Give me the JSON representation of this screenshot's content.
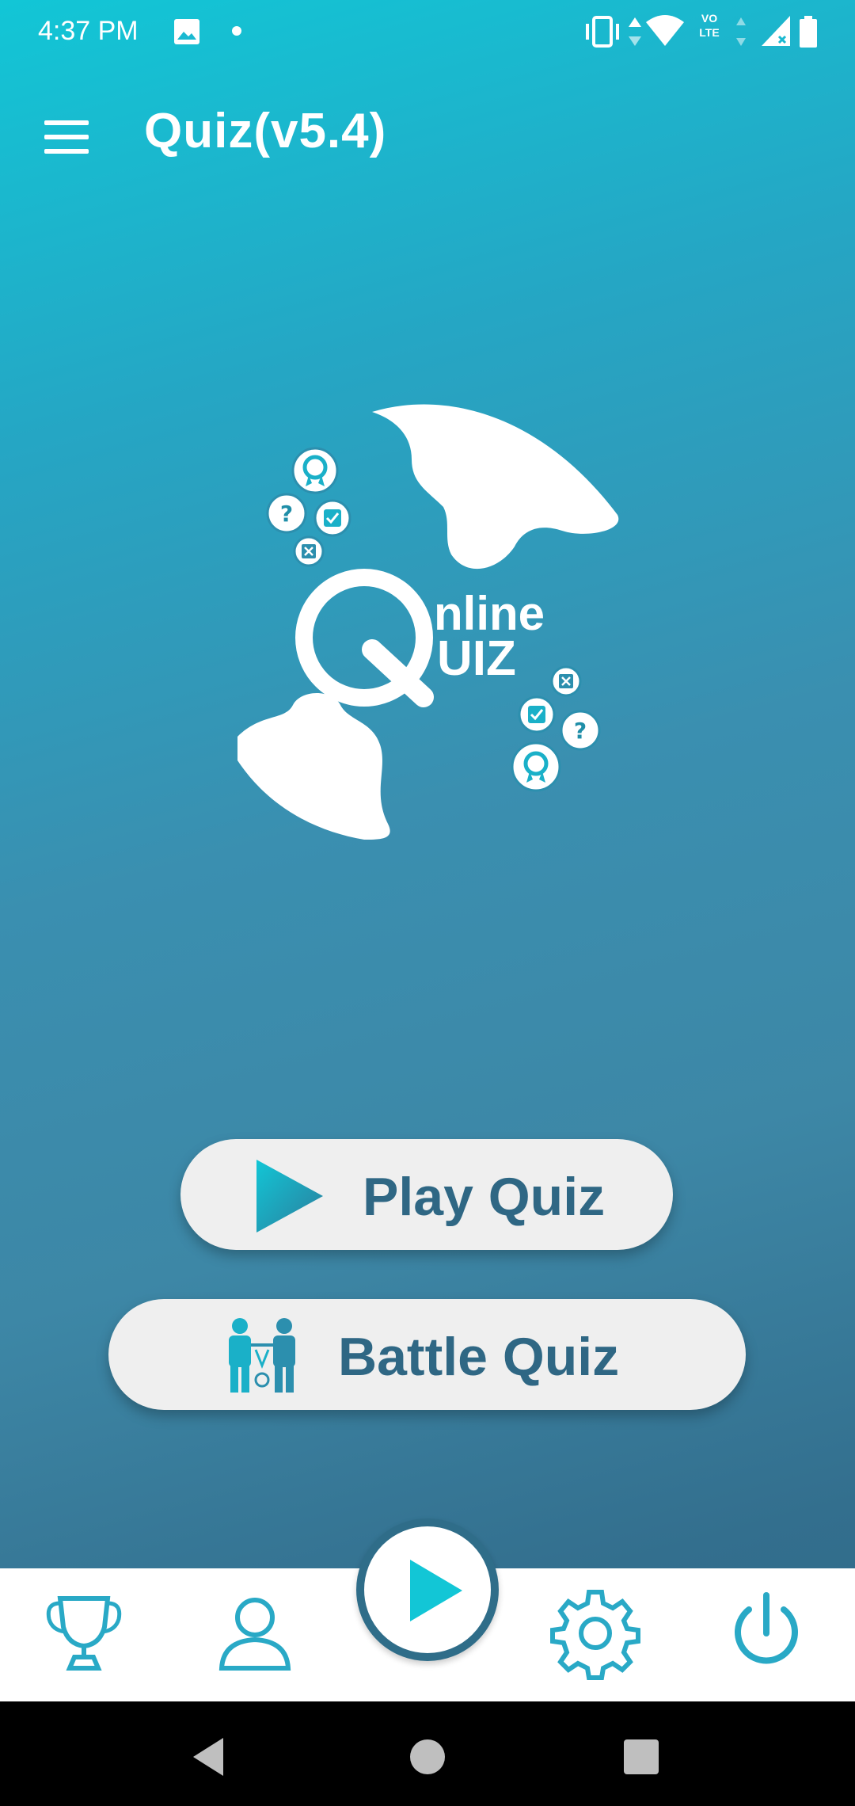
{
  "status_bar": {
    "time": "4:37 PM",
    "icons": [
      "image-icon",
      "dot-icon",
      "vibrate-icon",
      "data-arrows-icon",
      "wifi-icon",
      "volte-icon",
      "signal-icon",
      "battery-icon"
    ],
    "volte_label": "VO LTE"
  },
  "app_bar": {
    "title": "Quiz(v5.4)",
    "menu_icon": "hamburger-menu-icon"
  },
  "logo": {
    "line1": "nline",
    "line2": "UIZ",
    "big_letter": "Q"
  },
  "buttons": {
    "play_quiz": "Play Quiz",
    "battle_quiz": "Battle Quiz"
  },
  "bottom_nav": {
    "items": [
      "trophy-icon",
      "profile-icon",
      "play-icon",
      "settings-icon",
      "power-icon"
    ]
  },
  "colors": {
    "accent": "#12c6d6",
    "primary_dark": "#2f6784",
    "button_bg": "#efefef",
    "nav_icon": "#29a9c6"
  }
}
